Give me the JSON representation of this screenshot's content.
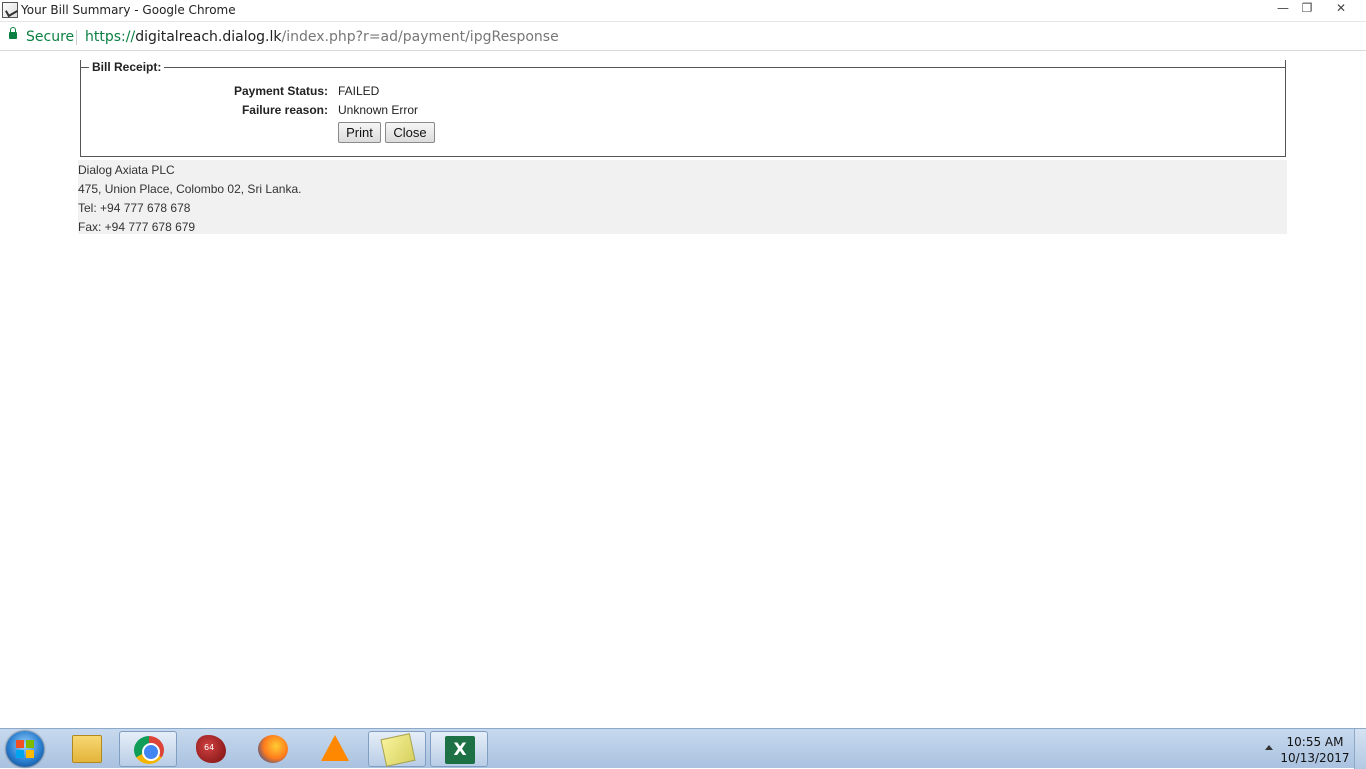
{
  "window": {
    "title": "Your Bill Summary - Google Chrome",
    "minimize_glyph": "—",
    "maximize_glyph": "❐",
    "close_glyph": "✕"
  },
  "addressbar": {
    "secure_label": "Secure",
    "url_scheme": "https://",
    "url_host": "digitalreach.dialog.lk",
    "url_path": "/index.php?r=ad/payment/ipgResponse"
  },
  "receipt": {
    "legend": "Bill Receipt:",
    "payment_status_label": "Payment Status:",
    "payment_status_value": "FAILED",
    "failure_reason_label": "Failure reason:",
    "failure_reason_value": "Unknown Error",
    "print_label": "Print",
    "close_label": "Close"
  },
  "footer": {
    "company": "Dialog Axiata PLC",
    "address": "475, Union Place, Colombo 02, Sri Lanka.",
    "tel": "Tel: +94 777 678 678",
    "fax": "Fax: +94 777 678 679"
  },
  "taskbar": {
    "apps": [
      "windows-explorer",
      "google-chrome",
      "gimp",
      "firefox",
      "vlc",
      "sticky-notes",
      "excel"
    ],
    "gimp_badge": "64",
    "excel_letter": "X",
    "time": "10:55 AM",
    "date": "10/13/2017"
  }
}
